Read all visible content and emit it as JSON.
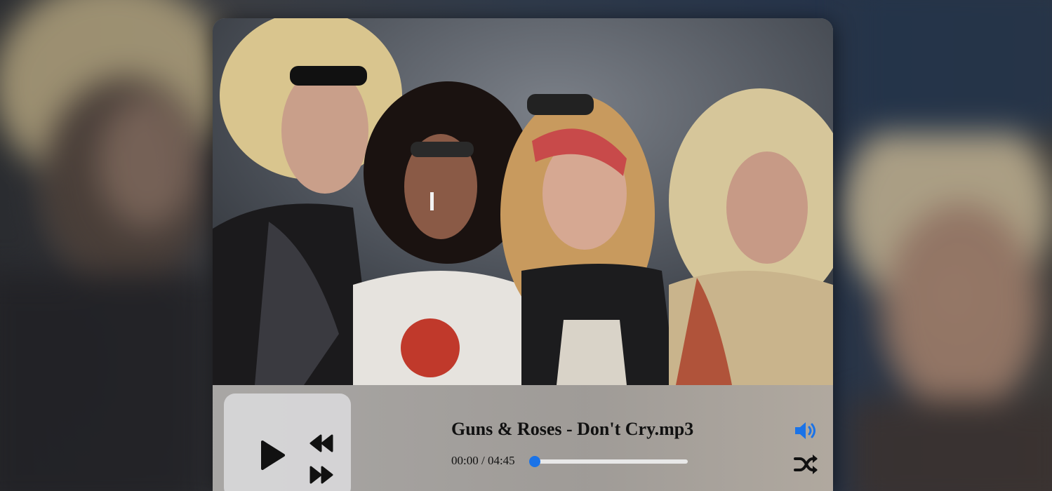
{
  "player": {
    "track_title": "Guns & Roses - Don't Cry.mp3",
    "time_display": "00:00 / 04:45",
    "progress_fraction": 0.0,
    "accent_color": "#1a73e8",
    "icons": {
      "play": "play-icon",
      "rewind": "rewind-icon",
      "fast_forward": "fast-forward-icon",
      "volume": "volume-icon",
      "shuffle": "shuffle-icon"
    }
  }
}
